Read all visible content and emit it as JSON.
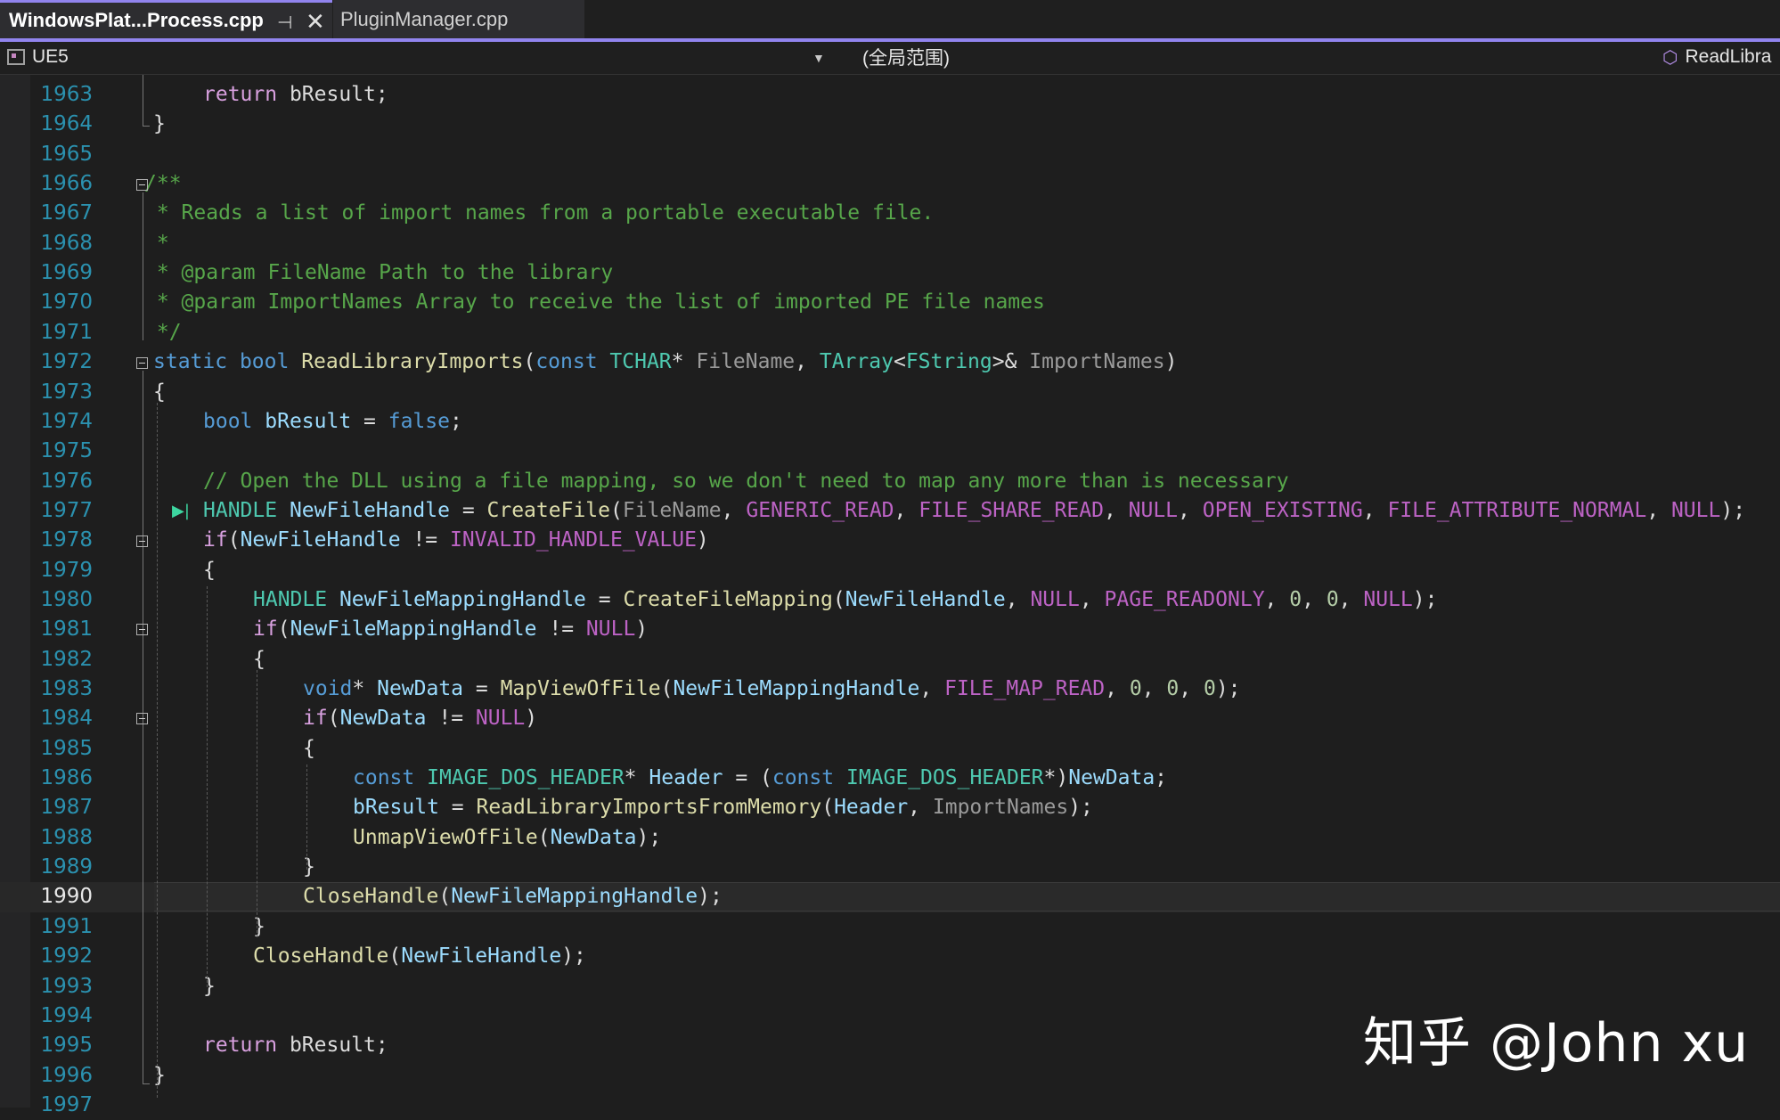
{
  "tabs": {
    "active": {
      "label": "WindowsPlat...Process.cpp",
      "pin_glyph": "⊣",
      "close_glyph": "✕"
    },
    "inactive": {
      "label": "PluginManager.cpp"
    }
  },
  "navbar": {
    "project": "UE5",
    "scope": "(全局范围)",
    "member": "ReadLibra"
  },
  "editor": {
    "current_line": 1990,
    "lines": [
      {
        "n": "1963",
        "tokens": [
          {
            "t": "return",
            "c": "ctl"
          },
          {
            "t": " bResult;",
            "c": "txt"
          }
        ]
      },
      {
        "n": "1964",
        "tokens": [
          {
            "t": "}",
            "c": "txt"
          }
        ]
      },
      {
        "n": "1965",
        "tokens": []
      },
      {
        "n": "1966",
        "tokens": [
          {
            "t": "/**",
            "c": "c"
          }
        ]
      },
      {
        "n": "1967",
        "tokens": [
          {
            "t": " * Reads a list of import names from a portable executable file.",
            "c": "c"
          }
        ]
      },
      {
        "n": "1968",
        "tokens": [
          {
            "t": " *",
            "c": "c"
          }
        ]
      },
      {
        "n": "1969",
        "tokens": [
          {
            "t": " * @param FileName Path to the library",
            "c": "c"
          }
        ]
      },
      {
        "n": "1970",
        "tokens": [
          {
            "t": " * @param ImportNames Array to receive the list of imported PE file names",
            "c": "c"
          }
        ]
      },
      {
        "n": "1971",
        "tokens": [
          {
            "t": " */",
            "c": "c"
          }
        ]
      },
      {
        "n": "1972",
        "tokens": [
          {
            "t": "static",
            "c": "k"
          },
          {
            "t": " ",
            "c": "txt"
          },
          {
            "t": "bool",
            "c": "k"
          },
          {
            "t": " ",
            "c": "txt"
          },
          {
            "t": "ReadLibraryImports",
            "c": "f"
          },
          {
            "t": "(",
            "c": "txt"
          },
          {
            "t": "const",
            "c": "k"
          },
          {
            "t": " ",
            "c": "txt"
          },
          {
            "t": "TCHAR",
            "c": "t"
          },
          {
            "t": "* ",
            "c": "txt"
          },
          {
            "t": "FileName",
            "c": "p"
          },
          {
            "t": ", ",
            "c": "txt"
          },
          {
            "t": "TArray",
            "c": "t"
          },
          {
            "t": "<",
            "c": "txt"
          },
          {
            "t": "FString",
            "c": "t"
          },
          {
            "t": ">& ",
            "c": "txt"
          },
          {
            "t": "ImportNames",
            "c": "p"
          },
          {
            "t": ")",
            "c": "txt"
          }
        ]
      },
      {
        "n": "1973",
        "tokens": [
          {
            "t": "{",
            "c": "txt"
          }
        ]
      },
      {
        "n": "1974",
        "tokens": [
          {
            "t": "bool",
            "c": "k"
          },
          {
            "t": " ",
            "c": "txt"
          },
          {
            "t": "bResult",
            "c": "v"
          },
          {
            "t": " = ",
            "c": "txt"
          },
          {
            "t": "false",
            "c": "k"
          },
          {
            "t": ";",
            "c": "txt"
          }
        ]
      },
      {
        "n": "1975",
        "tokens": []
      },
      {
        "n": "1976",
        "tokens": [
          {
            "t": "// Open the DLL using a file mapping, so we don't need to map any more than is necessary",
            "c": "c"
          }
        ]
      },
      {
        "n": "1977",
        "tokens": [
          {
            "t": "HANDLE",
            "c": "t"
          },
          {
            "t": " ",
            "c": "txt"
          },
          {
            "t": "NewFileHandle",
            "c": "v"
          },
          {
            "t": " = ",
            "c": "txt"
          },
          {
            "t": "CreateFile",
            "c": "f"
          },
          {
            "t": "(",
            "c": "txt"
          },
          {
            "t": "FileName",
            "c": "p"
          },
          {
            "t": ", ",
            "c": "txt"
          },
          {
            "t": "GENERIC_READ",
            "c": "m"
          },
          {
            "t": ", ",
            "c": "txt"
          },
          {
            "t": "FILE_SHARE_READ",
            "c": "m"
          },
          {
            "t": ", ",
            "c": "txt"
          },
          {
            "t": "NULL",
            "c": "m"
          },
          {
            "t": ", ",
            "c": "txt"
          },
          {
            "t": "OPEN_EXISTING",
            "c": "m"
          },
          {
            "t": ", ",
            "c": "txt"
          },
          {
            "t": "FILE_ATTRIBUTE_NORMAL",
            "c": "m"
          },
          {
            "t": ", ",
            "c": "txt"
          },
          {
            "t": "NULL",
            "c": "m"
          },
          {
            "t": ");",
            "c": "txt"
          }
        ]
      },
      {
        "n": "1978",
        "tokens": [
          {
            "t": "if",
            "c": "ctl"
          },
          {
            "t": "(",
            "c": "txt"
          },
          {
            "t": "NewFileHandle",
            "c": "v"
          },
          {
            "t": " != ",
            "c": "txt"
          },
          {
            "t": "INVALID_HANDLE_VALUE",
            "c": "m"
          },
          {
            "t": ")",
            "c": "txt"
          }
        ]
      },
      {
        "n": "1979",
        "tokens": [
          {
            "t": "{",
            "c": "txt"
          }
        ]
      },
      {
        "n": "1980",
        "tokens": [
          {
            "t": "HANDLE",
            "c": "t"
          },
          {
            "t": " ",
            "c": "txt"
          },
          {
            "t": "NewFileMappingHandle",
            "c": "v"
          },
          {
            "t": " = ",
            "c": "txt"
          },
          {
            "t": "CreateFileMapping",
            "c": "f"
          },
          {
            "t": "(",
            "c": "txt"
          },
          {
            "t": "NewFileHandle",
            "c": "v"
          },
          {
            "t": ", ",
            "c": "txt"
          },
          {
            "t": "NULL",
            "c": "m"
          },
          {
            "t": ", ",
            "c": "txt"
          },
          {
            "t": "PAGE_READONLY",
            "c": "m"
          },
          {
            "t": ", ",
            "c": "txt"
          },
          {
            "t": "0",
            "c": "n"
          },
          {
            "t": ", ",
            "c": "txt"
          },
          {
            "t": "0",
            "c": "n"
          },
          {
            "t": ", ",
            "c": "txt"
          },
          {
            "t": "NULL",
            "c": "m"
          },
          {
            "t": ");",
            "c": "txt"
          }
        ]
      },
      {
        "n": "1981",
        "tokens": [
          {
            "t": "if",
            "c": "ctl"
          },
          {
            "t": "(",
            "c": "txt"
          },
          {
            "t": "NewFileMappingHandle",
            "c": "v"
          },
          {
            "t": " != ",
            "c": "txt"
          },
          {
            "t": "NULL",
            "c": "m"
          },
          {
            "t": ")",
            "c": "txt"
          }
        ]
      },
      {
        "n": "1982",
        "tokens": [
          {
            "t": "{",
            "c": "txt"
          }
        ]
      },
      {
        "n": "1983",
        "tokens": [
          {
            "t": "void",
            "c": "k"
          },
          {
            "t": "* ",
            "c": "txt"
          },
          {
            "t": "NewData",
            "c": "v"
          },
          {
            "t": " = ",
            "c": "txt"
          },
          {
            "t": "MapViewOfFile",
            "c": "f"
          },
          {
            "t": "(",
            "c": "txt"
          },
          {
            "t": "NewFileMappingHandle",
            "c": "v"
          },
          {
            "t": ", ",
            "c": "txt"
          },
          {
            "t": "FILE_MAP_READ",
            "c": "m"
          },
          {
            "t": ", ",
            "c": "txt"
          },
          {
            "t": "0",
            "c": "n"
          },
          {
            "t": ", ",
            "c": "txt"
          },
          {
            "t": "0",
            "c": "n"
          },
          {
            "t": ", ",
            "c": "txt"
          },
          {
            "t": "0",
            "c": "n"
          },
          {
            "t": ");",
            "c": "txt"
          }
        ]
      },
      {
        "n": "1984",
        "tokens": [
          {
            "t": "if",
            "c": "ctl"
          },
          {
            "t": "(",
            "c": "txt"
          },
          {
            "t": "NewData",
            "c": "v"
          },
          {
            "t": " != ",
            "c": "txt"
          },
          {
            "t": "NULL",
            "c": "m"
          },
          {
            "t": ")",
            "c": "txt"
          }
        ]
      },
      {
        "n": "1985",
        "tokens": [
          {
            "t": "{",
            "c": "txt"
          }
        ]
      },
      {
        "n": "1986",
        "tokens": [
          {
            "t": "const",
            "c": "k"
          },
          {
            "t": " ",
            "c": "txt"
          },
          {
            "t": "IMAGE_DOS_HEADER",
            "c": "t"
          },
          {
            "t": "* ",
            "c": "txt"
          },
          {
            "t": "Header",
            "c": "v"
          },
          {
            "t": " = (",
            "c": "txt"
          },
          {
            "t": "const",
            "c": "k"
          },
          {
            "t": " ",
            "c": "txt"
          },
          {
            "t": "IMAGE_DOS_HEADER",
            "c": "t"
          },
          {
            "t": "*)",
            "c": "txt"
          },
          {
            "t": "NewData",
            "c": "v"
          },
          {
            "t": ";",
            "c": "txt"
          }
        ]
      },
      {
        "n": "1987",
        "tokens": [
          {
            "t": "bResult",
            "c": "v"
          },
          {
            "t": " = ",
            "c": "txt"
          },
          {
            "t": "ReadLibraryImportsFromMemory",
            "c": "f"
          },
          {
            "t": "(",
            "c": "txt"
          },
          {
            "t": "Header",
            "c": "v"
          },
          {
            "t": ", ",
            "c": "txt"
          },
          {
            "t": "ImportNames",
            "c": "p"
          },
          {
            "t": ");",
            "c": "txt"
          }
        ]
      },
      {
        "n": "1988",
        "tokens": [
          {
            "t": "UnmapViewOfFile",
            "c": "f"
          },
          {
            "t": "(",
            "c": "txt"
          },
          {
            "t": "NewData",
            "c": "v"
          },
          {
            "t": ");",
            "c": "txt"
          }
        ]
      },
      {
        "n": "1989",
        "tokens": [
          {
            "t": "}",
            "c": "txt"
          }
        ]
      },
      {
        "n": "1990",
        "tokens": [
          {
            "t": "CloseHandle",
            "c": "f"
          },
          {
            "t": "(",
            "c": "txt"
          },
          {
            "t": "NewFileMappingHandle",
            "c": "v"
          },
          {
            "t": ");",
            "c": "txt"
          }
        ]
      },
      {
        "n": "1991",
        "tokens": [
          {
            "t": "}",
            "c": "txt"
          }
        ]
      },
      {
        "n": "1992",
        "tokens": [
          {
            "t": "CloseHandle",
            "c": "f"
          },
          {
            "t": "(",
            "c": "txt"
          },
          {
            "t": "NewFileHandle",
            "c": "v"
          },
          {
            "t": ");",
            "c": "txt"
          }
        ]
      },
      {
        "n": "1993",
        "tokens": [
          {
            "t": "}",
            "c": "txt"
          }
        ]
      },
      {
        "n": "1994",
        "tokens": []
      },
      {
        "n": "1995",
        "tokens": [
          {
            "t": "return",
            "c": "ctl"
          },
          {
            "t": " bResult;",
            "c": "txt"
          }
        ]
      },
      {
        "n": "1996",
        "tokens": [
          {
            "t": "}",
            "c": "txt"
          }
        ]
      },
      {
        "n": "1997",
        "tokens": []
      }
    ]
  },
  "watermark": "知乎 @John xu",
  "colors": {
    "accent": "#9184ee",
    "keyword": "#569cd6",
    "comment": "#57a64a",
    "function": "#dcdcaa",
    "type": "#4ec9b0",
    "macro": "#bd63c5",
    "variable": "#9cdcfe",
    "line_number": "#2b91af"
  }
}
